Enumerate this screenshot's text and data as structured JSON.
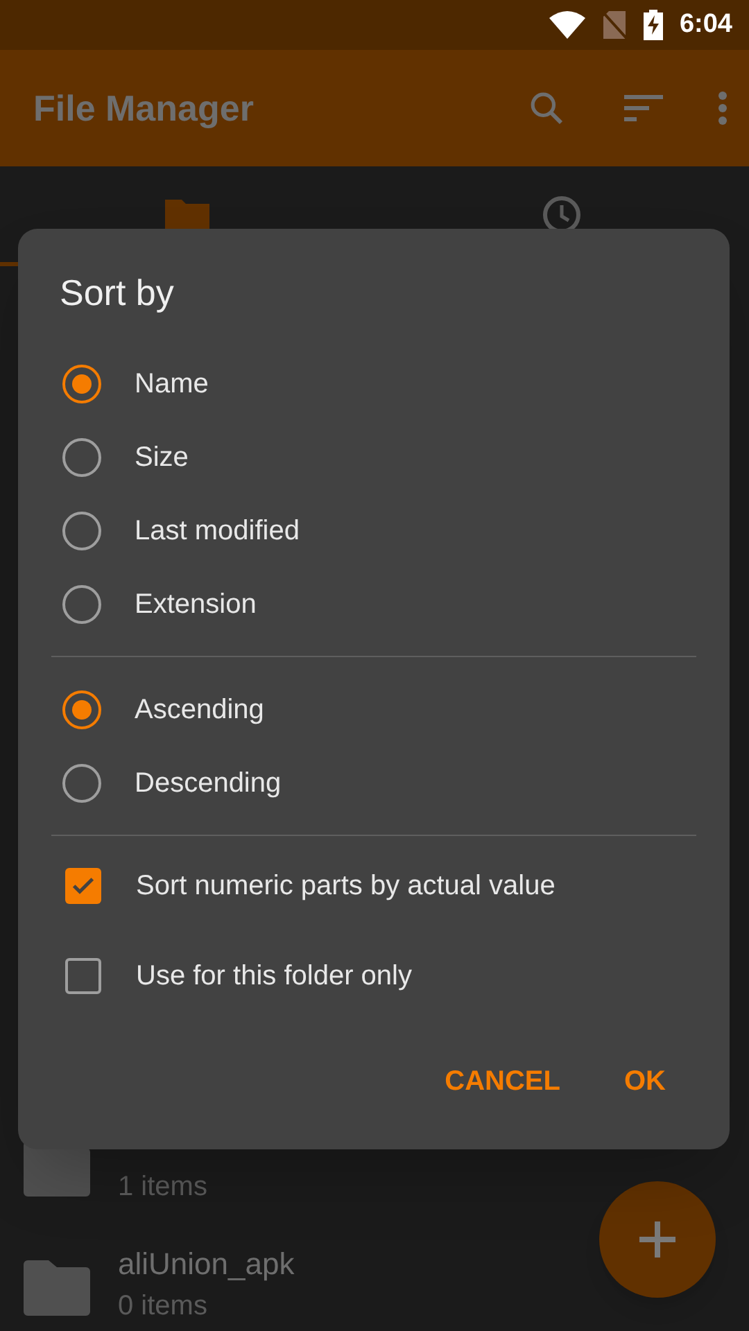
{
  "status_bar": {
    "time": "6:04"
  },
  "app_bar": {
    "title": "File Manager"
  },
  "tabs": [
    {
      "kind": "folder",
      "selected": true
    },
    {
      "kind": "recent",
      "selected": false
    }
  ],
  "files": [
    {
      "count": "1 items"
    },
    {
      "name": "aliUnion_apk",
      "count": "0 items"
    }
  ],
  "dialog": {
    "title": "Sort by",
    "sort_options": [
      {
        "label": "Name",
        "selected": true
      },
      {
        "label": "Size",
        "selected": false
      },
      {
        "label": "Last modified",
        "selected": false
      },
      {
        "label": "Extension",
        "selected": false
      }
    ],
    "order_options": [
      {
        "label": "Ascending",
        "selected": true
      },
      {
        "label": "Descending",
        "selected": false
      }
    ],
    "checkboxes": [
      {
        "label": "Sort numeric parts by actual value",
        "checked": true
      },
      {
        "label": "Use for this folder only",
        "checked": false
      }
    ],
    "buttons": [
      "CANCEL",
      "OK"
    ]
  }
}
